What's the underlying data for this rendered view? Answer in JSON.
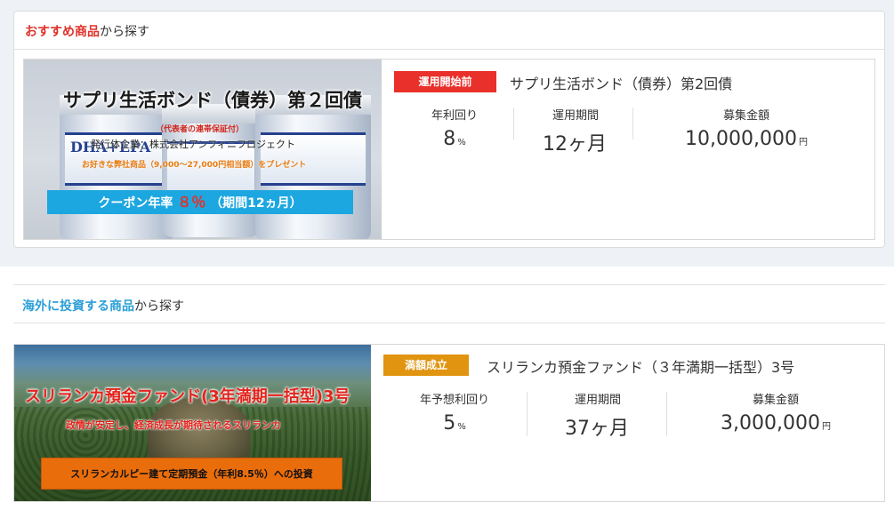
{
  "recommended": {
    "heading_highlight": "おすすめ商品",
    "heading_suffix": "から探す",
    "product": {
      "banner": {
        "title": "サプリ生活ボンド（債券）第２回債",
        "guarantee": "（代表者の連帯保証付）",
        "issuer": "発行体企業：株式会社アンフィニフロジェクト",
        "gift": "お好きな弊社商品（9,000～27,000円相当額）をプレゼント",
        "coupon_label": "クーポン年率",
        "coupon_rate": "８％",
        "coupon_term": "（期間12ヵ月）",
        "bottle_label": "DHA+EPA"
      },
      "status": "運用開始前",
      "name": "サプリ生活ボンド（債券）第2回債",
      "stats": [
        {
          "label": "年利回り",
          "value": "8",
          "unit": "%"
        },
        {
          "label": "運用期間",
          "value": "12ヶ月",
          "unit": ""
        },
        {
          "label": "募集金額",
          "value": "10,000,000",
          "unit": "円"
        }
      ]
    }
  },
  "overseas": {
    "heading_highlight": "海外に投資する商品",
    "heading_suffix": "から探す",
    "product": {
      "banner": {
        "title": "スリランカ預金ファンド(3年満期一括型)3号",
        "subtitle": "政情が安定し、経済成長が期待されるスリランカ",
        "invest": "スリランカルピー建て定期預金（年利8.5％）への投資"
      },
      "status": "満額成立",
      "name": "スリランカ預金ファンド（３年満期一括型）3号",
      "stats": [
        {
          "label": "年予想利回り",
          "value": "5",
          "unit": "%"
        },
        {
          "label": "運用期間",
          "value": "37ヶ月",
          "unit": ""
        },
        {
          "label": "募集金額",
          "value": "3,000,000",
          "unit": "円"
        }
      ]
    }
  },
  "colors": {
    "accent_red": "#e0322b",
    "accent_blue": "#2b9fd8",
    "badge_red": "#e9302a",
    "badge_orange": "#e09410"
  }
}
